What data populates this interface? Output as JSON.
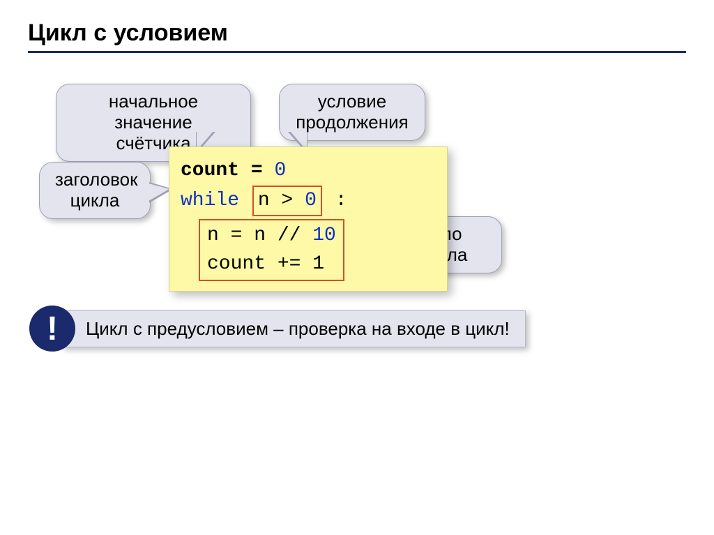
{
  "title": "Цикл с условием",
  "callouts": {
    "initial": {
      "line1": "начальное значение",
      "line2": "счётчика"
    },
    "condition": {
      "line1": "условие",
      "line2": "продолжения"
    },
    "header": {
      "line1": "заголовок",
      "line2": "цикла"
    },
    "body": "тело цикла"
  },
  "code": {
    "count_var": "count",
    "eq": "=",
    "zero": "0",
    "while_kw": "while",
    "cond_left": "n >",
    "cond_right": "0",
    "colon": ":",
    "body1_left": "n = n //",
    "body1_num": "10",
    "body2": "count += 1"
  },
  "note": {
    "excl": "!",
    "text": "Цикл с предусловием – проверка на входе в цикл!"
  }
}
